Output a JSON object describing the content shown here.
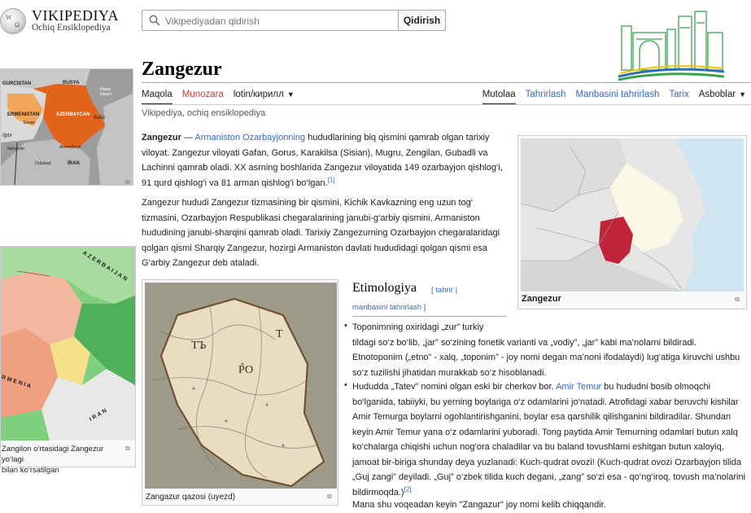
{
  "logo": {
    "wordmark": "VIKIPEDIYA",
    "tagline": "Ochiq Ensiklopediya",
    "glyph1": "W",
    "glyph2": "Ω"
  },
  "search": {
    "placeholder": "Vikipediyadan qidirish",
    "button": "Qidirish"
  },
  "page": {
    "title": "Zangezur",
    "tagline": "Vikipediya, ochiq ensiklopediya"
  },
  "tabs": {
    "left": [
      "Maqola",
      "Munozara",
      "lotin/кирилл"
    ],
    "right": [
      "Mutolaa",
      "Tahrirlash",
      "Manbasini tahrirlash",
      "Tarix",
      "Asboblar"
    ]
  },
  "intro": {
    "bold": "Zangezur",
    "dash": " — ",
    "link": "Armaniston Ozarbayjonning",
    "p1_line1_rest": " hududlarining biq qismini qamrab olgan tarixiy",
    "p1_line2": "viloyat. Zangezur viloyati Gafan, Gorus, Karakilsa (Sisian), Mugru, Zengilan, Gubadli va",
    "p1_line3": "Lachinni qamrab oladi. XX asrning boshlarida Zangezur viloyatida 149 ozarbayjon qishlog‘i,",
    "p1_line4": "91 qurd qishlog‘i va 81 arman qishlog‘i bo‘lgan.",
    "ref1": "[1]",
    "p2_line1": "Zangezur hududi Zangezur tizmasining bir qismini, Kichik Kavkazning eng uzun tog‘",
    "p2_line2": "tizmasini, Ozarbayjon Respublikasi chegaralarining janubi-g‘arbiy qismini, Armaniston",
    "p2_line3": "hududining janubi-sharqini qamrab oladi. Tarixiy Zangezurning Ozarbayjon chegaralaridagi",
    "p2_line4": "qolgan qismi Sharqiy Zangezur, hozirgi Armaniston davlati hududidagi qolgan qismi esa",
    "p2_line5": "G‘arbiy Zangezur deb ataladi."
  },
  "right_map": {
    "caption": "Zangezur"
  },
  "left_map1": {
    "labels": [
      "GURCISTAN",
      "RUSYA",
      "ERMENISTAN",
      "AZERBAYCAN",
      "Hazar Denizi",
      "Bakü",
      "İRAN",
      "Iğdır",
      "Nahçıvan",
      "Ordubad",
      "Ahmedbeyli",
      "Erivan"
    ]
  },
  "left_map2": {
    "labels": [
      "AZERBAIJAN",
      "RMENIA",
      "IRAN"
    ],
    "caption_line1": "Zangilon o‘rtasidagi Zangezur yo‘lagi",
    "caption_line2": "bilan ko‘rsatilgan"
  },
  "center_map": {
    "caption": "Zangazur qazosi (uyezd)",
    "labels": [
      "ТЪ",
      "РО",
      "Т"
    ]
  },
  "etymology": {
    "heading": "Etimologiya",
    "edit_open": "[ ",
    "edit1": "tahrir",
    "edit_sep": " |",
    "edit2": "manbasini tahrirlash",
    "edit_close": " ]",
    "b1_l1": "Toponimning oxiridagi „zur” turkiy",
    "b1_l2": "tildagi so‘z bo‘lib, „jar” so‘zining fonetik varianti va „vodiy”, „jar” kabi ma’nolarni bildiradi.",
    "b1_l3": "Etnotoponim („etno” - xalq, „toponim” - joy nomi degan ma’noni ifodalaydi) lug‘atiga kiruvchi ushbu",
    "b1_l4": "so‘z tuzilishi jihatidan murakkab so‘z hisoblanadi.",
    "b2_l1_pre": "Hududda „Tatev” nomini olgan eski bir cherkov bor. ",
    "b2_l1_link": "Amir Temur",
    "b2_l1_post": " bu hududni bosib olmoqchi",
    "b2_l2": "bo‘lganida, tabiiyki, bu yerning boylariga o‘z odamlarini jo‘natadi. Atrofidagi xabar beruvchi kishilar",
    "b2_l3": "Amir Temurga boylarni ogohlantirishganini, boylar esa qarshilik qilishganini bildiradilar. Shundan",
    "b2_l4": "keyin Amir Temur yana o‘z odamlarini yuboradi. Tong paytida Amir Temurning odamlari butun xalq",
    "b2_l5": "ko‘chalarga chiqishi uchun nog‘ora chaladilar va bu baland tovushlarni eshitgan butun xaloyiq,",
    "b2_l6": "jamoat bir-biriga shunday deya yuzlanadi: Kuch-qudrat ovozi! (Kuch-qudrat ovozi Ozarbayjon tilida",
    "b2_l7": "„Guj zangi” deyiladi. „Guj” o‘zbek tilida kuch degani, „zang” so‘zi esa - qo‘ng‘iroq, tovush ma’nolarini",
    "b2_l8": "bildirmoqda.)",
    "ref2": "[2]",
    "after": "Mana shu voqeadan keyin \"Zangazur\" joy nomi kelib chiqqandir."
  },
  "colors": {
    "link": "#3366cc",
    "red_link": "#d73333",
    "region_highlight": "#c0243a",
    "map_land": "#e6e6e6",
    "map_sea": "#cfe5f2",
    "banner_green": "#3aa34a",
    "banner_blue": "#2f6fb5"
  }
}
